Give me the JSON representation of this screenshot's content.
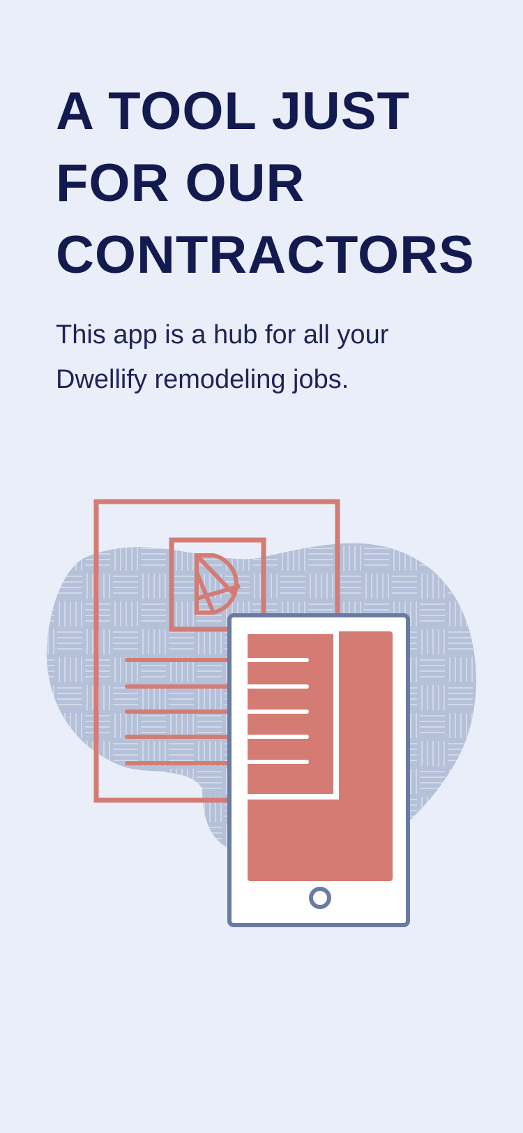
{
  "onboarding": {
    "headline_lines": [
      "A TOOL JUST",
      "FOR OUR",
      "CONTRACTORS"
    ],
    "subtitle_line1": "This app is a hub for all your",
    "subtitle_line2": "Dwellify remodeling jobs."
  },
  "colors": {
    "background": "#eaeef8",
    "headline": "#121a4f",
    "accent_coral": "#d47b74",
    "blob": "#b5c1d9",
    "phone_frame": "#6a7ba3"
  },
  "illustration": {
    "icon": "document-and-phone-illustration"
  }
}
